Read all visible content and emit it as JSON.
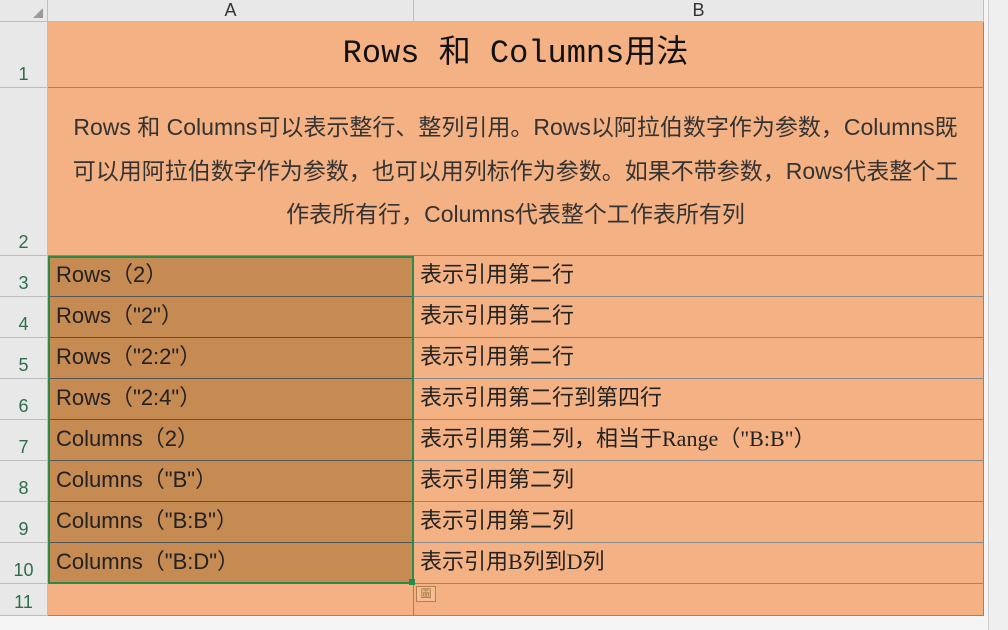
{
  "columns": {
    "A": "A",
    "B": "B"
  },
  "rowNumbers": [
    "1",
    "2",
    "3",
    "4",
    "5",
    "6",
    "7",
    "8",
    "9",
    "10",
    "11"
  ],
  "title": "Rows 和 Columns用法",
  "description": "Rows 和 Columns可以表示整行、整列引用。Rows以阿拉伯数字作为参数，Columns既可以用阿拉伯数字作为参数，也可以用列标作为参数。如果不带参数，Rows代表整个工作表所有行，Columns代表整个工作表所有列",
  "rows": [
    {
      "a": "Rows（2）",
      "b": "表示引用第二行"
    },
    {
      "a": "Rows（\"2\"）",
      "b": "表示引用第二行"
    },
    {
      "a": "Rows（\"2:2\"）",
      "b": "表示引用第二行"
    },
    {
      "a": "Rows（\"2:4\"）",
      "b": "表示引用第二行到第四行"
    },
    {
      "a": "Columns（2）",
      "b": "表示引用第二列，相当于Range（\"B:B\"）"
    },
    {
      "a": "Columns（\"B\"）",
      "b": "表示引用第二列"
    },
    {
      "a": "Columns（\"B:B\"）",
      "b": "表示引用第二列"
    },
    {
      "a": "Columns（\"B:D\"）",
      "b": "表示引用B列到D列"
    }
  ],
  "pasteIcon": "圖"
}
